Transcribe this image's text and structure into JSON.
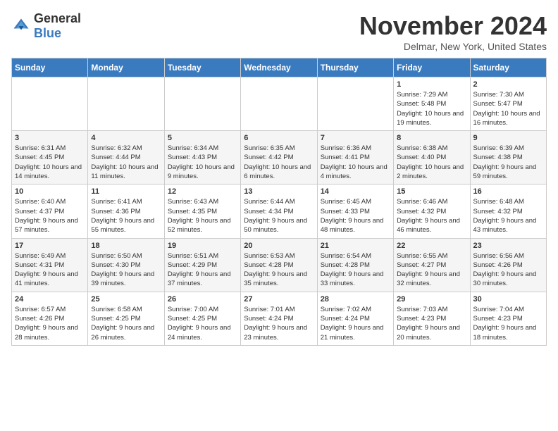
{
  "logo": {
    "text_general": "General",
    "text_blue": "Blue"
  },
  "title": "November 2024",
  "location": "Delmar, New York, United States",
  "days_of_week": [
    "Sunday",
    "Monday",
    "Tuesday",
    "Wednesday",
    "Thursday",
    "Friday",
    "Saturday"
  ],
  "weeks": [
    [
      {
        "day": "",
        "info": ""
      },
      {
        "day": "",
        "info": ""
      },
      {
        "day": "",
        "info": ""
      },
      {
        "day": "",
        "info": ""
      },
      {
        "day": "",
        "info": ""
      },
      {
        "day": "1",
        "info": "Sunrise: 7:29 AM\nSunset: 5:48 PM\nDaylight: 10 hours and 19 minutes."
      },
      {
        "day": "2",
        "info": "Sunrise: 7:30 AM\nSunset: 5:47 PM\nDaylight: 10 hours and 16 minutes."
      }
    ],
    [
      {
        "day": "3",
        "info": "Sunrise: 6:31 AM\nSunset: 4:45 PM\nDaylight: 10 hours and 14 minutes."
      },
      {
        "day": "4",
        "info": "Sunrise: 6:32 AM\nSunset: 4:44 PM\nDaylight: 10 hours and 11 minutes."
      },
      {
        "day": "5",
        "info": "Sunrise: 6:34 AM\nSunset: 4:43 PM\nDaylight: 10 hours and 9 minutes."
      },
      {
        "day": "6",
        "info": "Sunrise: 6:35 AM\nSunset: 4:42 PM\nDaylight: 10 hours and 6 minutes."
      },
      {
        "day": "7",
        "info": "Sunrise: 6:36 AM\nSunset: 4:41 PM\nDaylight: 10 hours and 4 minutes."
      },
      {
        "day": "8",
        "info": "Sunrise: 6:38 AM\nSunset: 4:40 PM\nDaylight: 10 hours and 2 minutes."
      },
      {
        "day": "9",
        "info": "Sunrise: 6:39 AM\nSunset: 4:38 PM\nDaylight: 9 hours and 59 minutes."
      }
    ],
    [
      {
        "day": "10",
        "info": "Sunrise: 6:40 AM\nSunset: 4:37 PM\nDaylight: 9 hours and 57 minutes."
      },
      {
        "day": "11",
        "info": "Sunrise: 6:41 AM\nSunset: 4:36 PM\nDaylight: 9 hours and 55 minutes."
      },
      {
        "day": "12",
        "info": "Sunrise: 6:43 AM\nSunset: 4:35 PM\nDaylight: 9 hours and 52 minutes."
      },
      {
        "day": "13",
        "info": "Sunrise: 6:44 AM\nSunset: 4:34 PM\nDaylight: 9 hours and 50 minutes."
      },
      {
        "day": "14",
        "info": "Sunrise: 6:45 AM\nSunset: 4:33 PM\nDaylight: 9 hours and 48 minutes."
      },
      {
        "day": "15",
        "info": "Sunrise: 6:46 AM\nSunset: 4:32 PM\nDaylight: 9 hours and 46 minutes."
      },
      {
        "day": "16",
        "info": "Sunrise: 6:48 AM\nSunset: 4:32 PM\nDaylight: 9 hours and 43 minutes."
      }
    ],
    [
      {
        "day": "17",
        "info": "Sunrise: 6:49 AM\nSunset: 4:31 PM\nDaylight: 9 hours and 41 minutes."
      },
      {
        "day": "18",
        "info": "Sunrise: 6:50 AM\nSunset: 4:30 PM\nDaylight: 9 hours and 39 minutes."
      },
      {
        "day": "19",
        "info": "Sunrise: 6:51 AM\nSunset: 4:29 PM\nDaylight: 9 hours and 37 minutes."
      },
      {
        "day": "20",
        "info": "Sunrise: 6:53 AM\nSunset: 4:28 PM\nDaylight: 9 hours and 35 minutes."
      },
      {
        "day": "21",
        "info": "Sunrise: 6:54 AM\nSunset: 4:28 PM\nDaylight: 9 hours and 33 minutes."
      },
      {
        "day": "22",
        "info": "Sunrise: 6:55 AM\nSunset: 4:27 PM\nDaylight: 9 hours and 32 minutes."
      },
      {
        "day": "23",
        "info": "Sunrise: 6:56 AM\nSunset: 4:26 PM\nDaylight: 9 hours and 30 minutes."
      }
    ],
    [
      {
        "day": "24",
        "info": "Sunrise: 6:57 AM\nSunset: 4:26 PM\nDaylight: 9 hours and 28 minutes."
      },
      {
        "day": "25",
        "info": "Sunrise: 6:58 AM\nSunset: 4:25 PM\nDaylight: 9 hours and 26 minutes."
      },
      {
        "day": "26",
        "info": "Sunrise: 7:00 AM\nSunset: 4:25 PM\nDaylight: 9 hours and 24 minutes."
      },
      {
        "day": "27",
        "info": "Sunrise: 7:01 AM\nSunset: 4:24 PM\nDaylight: 9 hours and 23 minutes."
      },
      {
        "day": "28",
        "info": "Sunrise: 7:02 AM\nSunset: 4:24 PM\nDaylight: 9 hours and 21 minutes."
      },
      {
        "day": "29",
        "info": "Sunrise: 7:03 AM\nSunset: 4:23 PM\nDaylight: 9 hours and 20 minutes."
      },
      {
        "day": "30",
        "info": "Sunrise: 7:04 AM\nSunset: 4:23 PM\nDaylight: 9 hours and 18 minutes."
      }
    ]
  ]
}
